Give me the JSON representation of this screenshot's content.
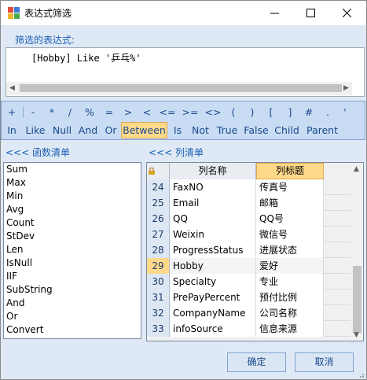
{
  "window": {
    "title": "表达式筛选",
    "minimize_glyph": "—",
    "maximize_glyph": "☐",
    "close_glyph": "✕"
  },
  "expression": {
    "label": "筛选的表达式:",
    "value": "[Hobby] Like '乒乓%'"
  },
  "operators": {
    "row1": [
      "+",
      "-",
      "*",
      "/",
      "%",
      "=",
      ">",
      "<",
      "<=",
      ">=",
      "<>",
      "(",
      ")",
      "[",
      "]",
      "#",
      ".",
      "'"
    ],
    "row2": [
      "In",
      "Like",
      "Null",
      "And",
      "Or",
      "Between",
      "Is",
      "Not",
      "True",
      "False",
      "Child",
      "Parent"
    ],
    "active": "Between"
  },
  "functions": {
    "header": "<<< 函数清单",
    "items": [
      "Sum",
      "Max",
      "Min",
      "Avg",
      "Count",
      "StDev",
      "Len",
      "IsNull",
      "IIF",
      "SubString",
      "And",
      "Or",
      "Convert"
    ]
  },
  "columns": {
    "header": "<<< 列清单",
    "col_name_header": "列名称",
    "col_title_header": "列标题",
    "selected_row": "29",
    "rows": [
      {
        "num": "24",
        "name": "FaxNO",
        "title": "传真号"
      },
      {
        "num": "25",
        "name": "Email",
        "title": "邮箱"
      },
      {
        "num": "26",
        "name": "QQ",
        "title": "QQ号"
      },
      {
        "num": "27",
        "name": "Weixin",
        "title": "微信号"
      },
      {
        "num": "28",
        "name": "ProgressStatus",
        "title": "进展状态"
      },
      {
        "num": "29",
        "name": "Hobby",
        "title": "爱好"
      },
      {
        "num": "30",
        "name": "Specialty",
        "title": "专业"
      },
      {
        "num": "31",
        "name": "PrePayPercent",
        "title": "预付比例"
      },
      {
        "num": "32",
        "name": "CompanyName",
        "title": "公司名称"
      },
      {
        "num": "33",
        "name": "infoSource",
        "title": "信息来源"
      }
    ]
  },
  "buttons": {
    "ok": "确定",
    "cancel": "取消"
  }
}
